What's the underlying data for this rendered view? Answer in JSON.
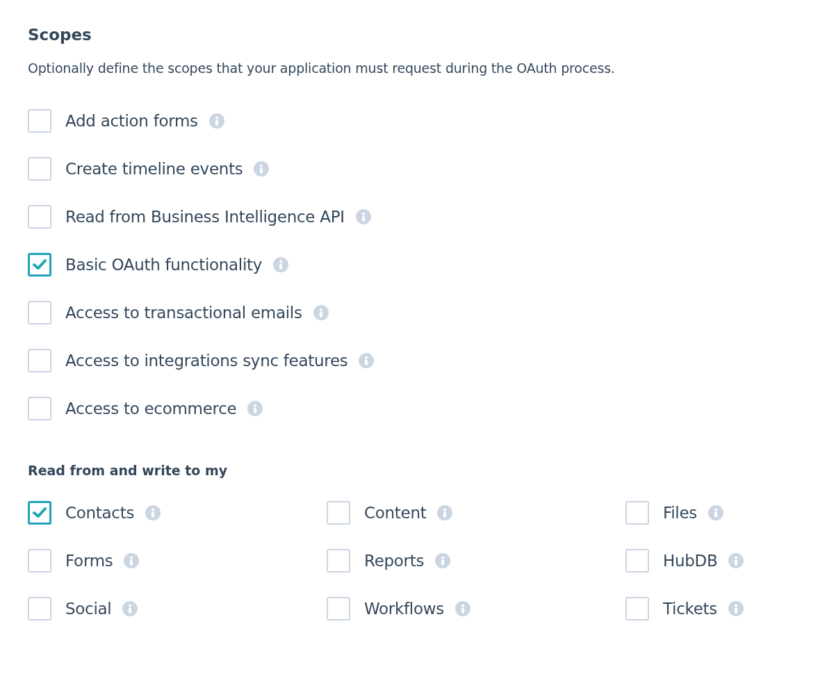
{
  "title": "Scopes",
  "description": "Optionally define the scopes that your application must request during the OAuth process.",
  "scopes": [
    {
      "label": "Add action forms",
      "checked": false
    },
    {
      "label": "Create timeline events",
      "checked": false
    },
    {
      "label": "Read from Business Intelligence API",
      "checked": false
    },
    {
      "label": "Basic OAuth functionality",
      "checked": true
    },
    {
      "label": "Access to transactional emails",
      "checked": false
    },
    {
      "label": "Access to integrations sync features",
      "checked": false
    },
    {
      "label": "Access to ecommerce",
      "checked": false
    }
  ],
  "read_write": {
    "heading": "Read from and write to my",
    "items": [
      {
        "label": "Contacts",
        "checked": true
      },
      {
        "label": "Content",
        "checked": false
      },
      {
        "label": "Files",
        "checked": false
      },
      {
        "label": "Forms",
        "checked": false
      },
      {
        "label": "Reports",
        "checked": false
      },
      {
        "label": "HubDB",
        "checked": false
      },
      {
        "label": "Social",
        "checked": false
      },
      {
        "label": "Workflows",
        "checked": false
      },
      {
        "label": "Tickets",
        "checked": false
      }
    ]
  }
}
